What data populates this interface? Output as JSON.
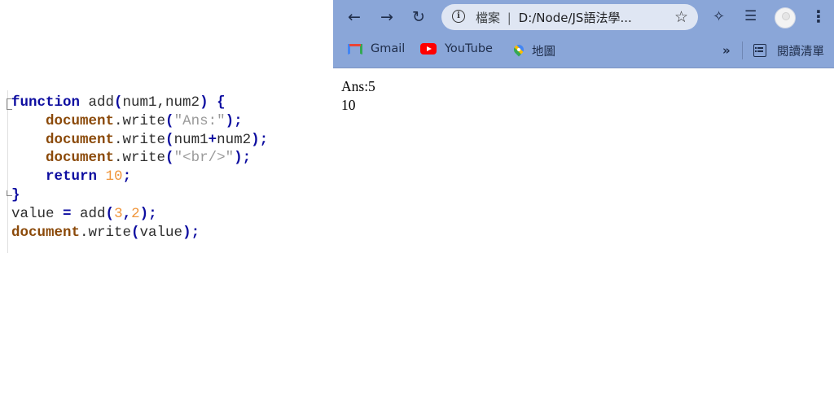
{
  "editor": {
    "lines": [
      [
        {
          "t": "function",
          "c": "kw"
        },
        {
          "t": " add",
          "c": "txt"
        },
        {
          "t": "(",
          "c": "op"
        },
        {
          "t": "num1,num2",
          "c": "txt"
        },
        {
          "t": ")",
          "c": "op"
        },
        {
          "t": " {",
          "c": "op"
        }
      ],
      [
        {
          "t": "    ",
          "c": "txt"
        },
        {
          "t": "document",
          "c": "obj"
        },
        {
          "t": ".write",
          "c": "txt"
        },
        {
          "t": "(",
          "c": "op"
        },
        {
          "t": "\"Ans:\"",
          "c": "str"
        },
        {
          "t": ");",
          "c": "op"
        }
      ],
      [
        {
          "t": "    ",
          "c": "txt"
        },
        {
          "t": "document",
          "c": "obj"
        },
        {
          "t": ".write",
          "c": "txt"
        },
        {
          "t": "(",
          "c": "op"
        },
        {
          "t": "num1",
          "c": "txt"
        },
        {
          "t": "+",
          "c": "op"
        },
        {
          "t": "num2",
          "c": "txt"
        },
        {
          "t": ");",
          "c": "op"
        }
      ],
      [
        {
          "t": "    ",
          "c": "txt"
        },
        {
          "t": "document",
          "c": "obj"
        },
        {
          "t": ".write",
          "c": "txt"
        },
        {
          "t": "(",
          "c": "op"
        },
        {
          "t": "\"<br/>\"",
          "c": "str"
        },
        {
          "t": ");",
          "c": "op"
        }
      ],
      [
        {
          "t": "    ",
          "c": "txt"
        },
        {
          "t": "return",
          "c": "kw"
        },
        {
          "t": " ",
          "c": "txt"
        },
        {
          "t": "10",
          "c": "num"
        },
        {
          "t": ";",
          "c": "op"
        }
      ],
      [
        {
          "t": "}",
          "c": "op"
        }
      ],
      [
        {
          "t": "value ",
          "c": "txt"
        },
        {
          "t": "=",
          "c": "op"
        },
        {
          "t": " add",
          "c": "txt"
        },
        {
          "t": "(",
          "c": "op"
        },
        {
          "t": "3",
          "c": "num"
        },
        {
          "t": ",",
          "c": "op"
        },
        {
          "t": "2",
          "c": "num"
        },
        {
          "t": ");",
          "c": "op"
        }
      ],
      [
        {
          "t": "document",
          "c": "obj"
        },
        {
          "t": ".write",
          "c": "txt"
        },
        {
          "t": "(",
          "c": "op"
        },
        {
          "t": "value",
          "c": "txt"
        },
        {
          "t": ");",
          "c": "op"
        }
      ]
    ]
  },
  "browser": {
    "omnibox": {
      "scheme": "檔案",
      "separator": "|",
      "url": "D:/Node/JS語法學..."
    },
    "bookmarks": [
      {
        "label": "Gmail",
        "icon": "gmail-icon"
      },
      {
        "label": "YouTube",
        "icon": "youtube-icon"
      },
      {
        "label": "地圖",
        "icon": "maps-icon"
      }
    ],
    "more_label": "»",
    "reading_list_label": "閱讀清單",
    "page_output": [
      "Ans:5",
      "10"
    ]
  },
  "colors": {
    "chrome_frame": "#8aa6d8",
    "keyword": "#0d0da0",
    "object": "#8b4a0a",
    "string": "#9a9a9a",
    "number": "#f0963c"
  }
}
